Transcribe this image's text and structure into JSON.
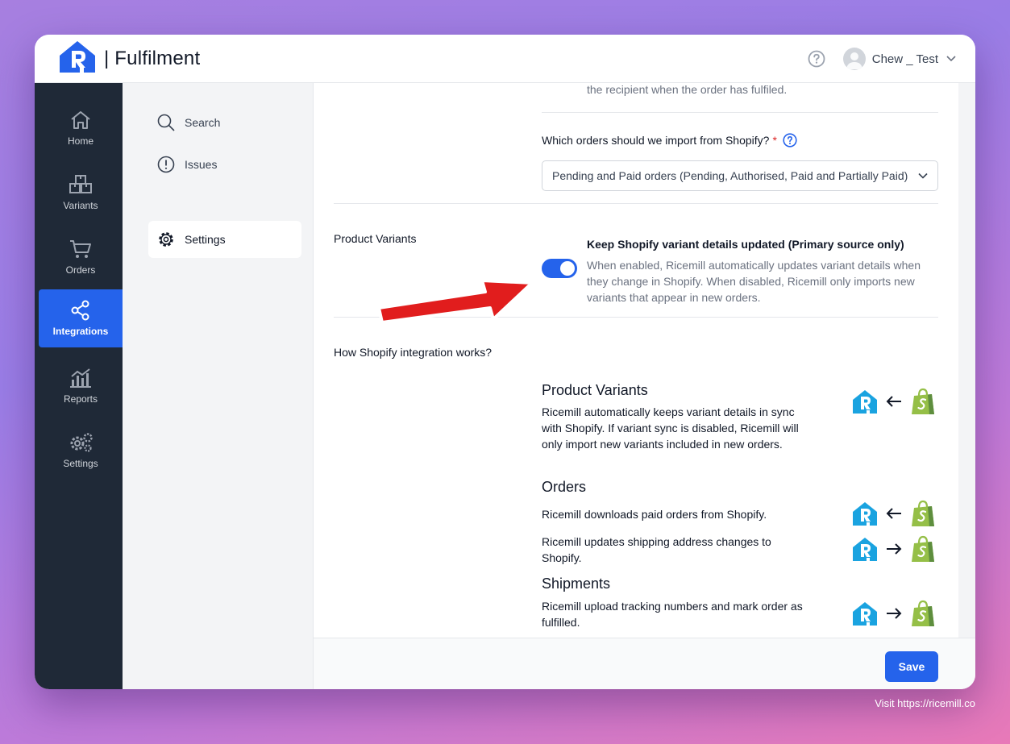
{
  "app": {
    "title": "| Fulfilment"
  },
  "header": {
    "user_name": "Chew _ Test"
  },
  "rail": {
    "items": [
      {
        "label": "Home"
      },
      {
        "label": "Variants"
      },
      {
        "label": "Orders"
      },
      {
        "label": "Integrations",
        "active": true
      },
      {
        "label": "Reports"
      },
      {
        "label": "Settings"
      }
    ]
  },
  "subnav": {
    "items": [
      {
        "label": "Search"
      },
      {
        "label": "Issues"
      },
      {
        "label": "Settings",
        "active": true
      }
    ]
  },
  "main": {
    "clipped_text": "the recipient when the order has fulfiled.",
    "import_question": "Which orders should we import from Shopify?",
    "required_mark": "*",
    "import_select_value": "Pending and Paid orders (Pending, Authorised, Paid and Partially Paid)",
    "product_variants_section": {
      "label": "Product Variants",
      "toggle_on": true,
      "option_title": "Keep Shopify variant details updated (Primary source only)",
      "option_desc": "When enabled, Ricemill automatically updates variant details when they change in Shopify. When disabled, Ricemill only imports new variants that appear in new orders."
    },
    "how_section": {
      "label": "How Shopify integration works?",
      "groups": [
        {
          "heading": "Product Variants",
          "rows": [
            {
              "text": "Ricemill automatically keeps variant details in sync with Shopify. If variant sync is disabled, Ricemill will only import new variants included in new orders.",
              "direction": "left"
            }
          ]
        },
        {
          "heading": "Orders",
          "rows": [
            {
              "text": "Ricemill downloads paid orders from Shopify.",
              "direction": "left"
            },
            {
              "text": "Ricemill updates shipping address changes to Shopify.",
              "direction": "right"
            }
          ]
        },
        {
          "heading": "Shipments",
          "rows": [
            {
              "text": "Ricemill upload tracking numbers and mark order as fulfilled.",
              "direction": "right"
            }
          ]
        }
      ]
    }
  },
  "footer": {
    "save_label": "Save"
  },
  "watermark": "Visit https://ricemill.co",
  "colors": {
    "primary": "#2563eb",
    "rail_bg": "#1f2937",
    "shopify_green": "#95bf47",
    "ricemill_blue": "#1aa3e0",
    "annotation_red": "#e11d1d"
  }
}
